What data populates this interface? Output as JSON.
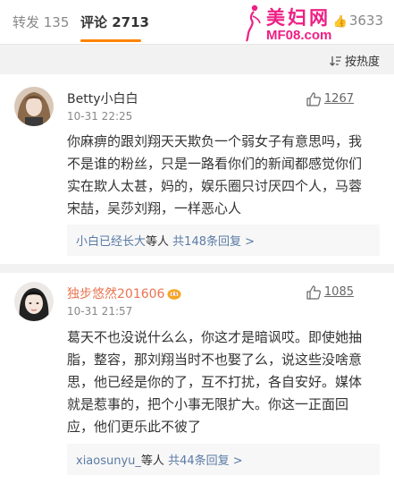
{
  "tabs": {
    "repost": "转发 135",
    "comment": "评论 2713",
    "like": "3633"
  },
  "watermark": {
    "name": "美妇网",
    "url": "MF08.com"
  },
  "sort": {
    "label": "按热度"
  },
  "comments": [
    {
      "user": "Betty小白白",
      "time": "10-31 22:25",
      "likes": "1267",
      "lines": [
        "你麻痹的跟刘翔天天欺负一个弱女子有意思吗，我",
        "不是谁的粉丝，只是一路看你们的新闻都感觉你们",
        "实在欺人太甚，妈的，娱乐圈只讨厌四个人，马蓉",
        "宋喆，吴莎刘翔，一样恶心人"
      ],
      "reply_user": "小白已经长大",
      "reply_text": "等人",
      "reply_count": "共148条回复 >"
    },
    {
      "user": "独步悠然201606",
      "time": "10-31 21:57",
      "likes": "1085",
      "lines": [
        "葛天不也没说什么么，你这才是暗讽哎。即使她抽",
        "脂，整容，那刘翔当时不也娶了么，说这些没啥意",
        "思，他已经是你的了，互不打扰，各自安好。媒体",
        "就是惹事的，把个小事无限扩大。你这一正面回",
        "应，他们更乐此不彼了"
      ],
      "reply_user": "xiaosunyu_",
      "reply_text": "等人",
      "reply_count": "共44条回复 >"
    }
  ],
  "colors": {
    "accent": "#ff8200",
    "link": "#5b7ba6",
    "username_orange": "#eb7350",
    "watermark": "#ee1f84"
  }
}
